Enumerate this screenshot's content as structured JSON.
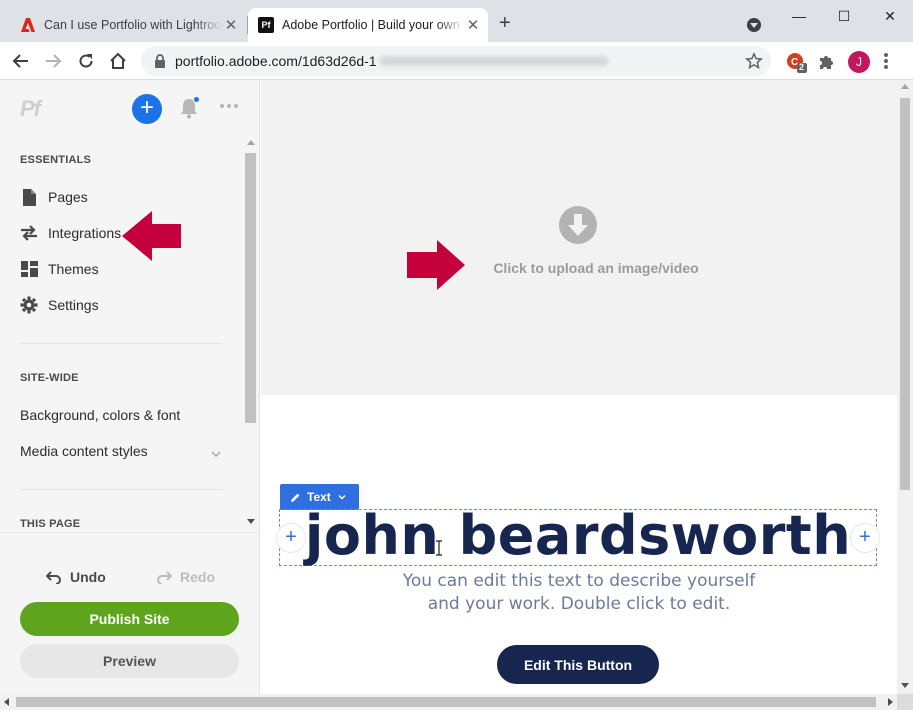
{
  "browser": {
    "tabs": [
      {
        "title": "Can I use Portfolio with Lightroom",
        "favicon": "adobe-icon",
        "active": false
      },
      {
        "title": "Adobe Portfolio | Build your own",
        "favicon": "pf-icon",
        "favicon_text": "Pf",
        "active": true
      }
    ],
    "new_tab_label": "+",
    "address": "portfolio.adobe.com/1d63d26d-1",
    "extension_badge": "2",
    "profile_initial": "J",
    "window_controls": {
      "minimize": "—",
      "maximize": "☐",
      "close": "✕"
    }
  },
  "sidebar": {
    "logo": "Pf",
    "add_label": "+",
    "essentials_label": "ESSENTIALS",
    "essentials": [
      {
        "label": "Pages",
        "icon": "page-icon"
      },
      {
        "label": "Integrations",
        "icon": "swap-arrows-icon"
      },
      {
        "label": "Themes",
        "icon": "grid-icon"
      },
      {
        "label": "Settings",
        "icon": "gear-icon"
      }
    ],
    "sitewide_label": "SITE-WIDE",
    "sitewide": [
      {
        "label": "Background, colors & font"
      },
      {
        "label": "Media content styles"
      }
    ],
    "thispage_label": "THIS PAGE",
    "undo_label": "Undo",
    "redo_label": "Redo",
    "publish_label": "Publish Site",
    "preview_label": "Preview"
  },
  "canvas": {
    "upload_text": "Click to upload an image/video",
    "text_chip_label": "Text",
    "headline": "john beardsworth",
    "description_line1": "You can edit this text to describe yourself",
    "description_line2": "and your work. Double click to edit.",
    "button_label": "Edit This Button"
  },
  "colors": {
    "accent_blue": "#1a73e8",
    "publish_green": "#5ea51d",
    "headline_navy": "#16264f",
    "annotation_arrow": "#c4003d"
  }
}
